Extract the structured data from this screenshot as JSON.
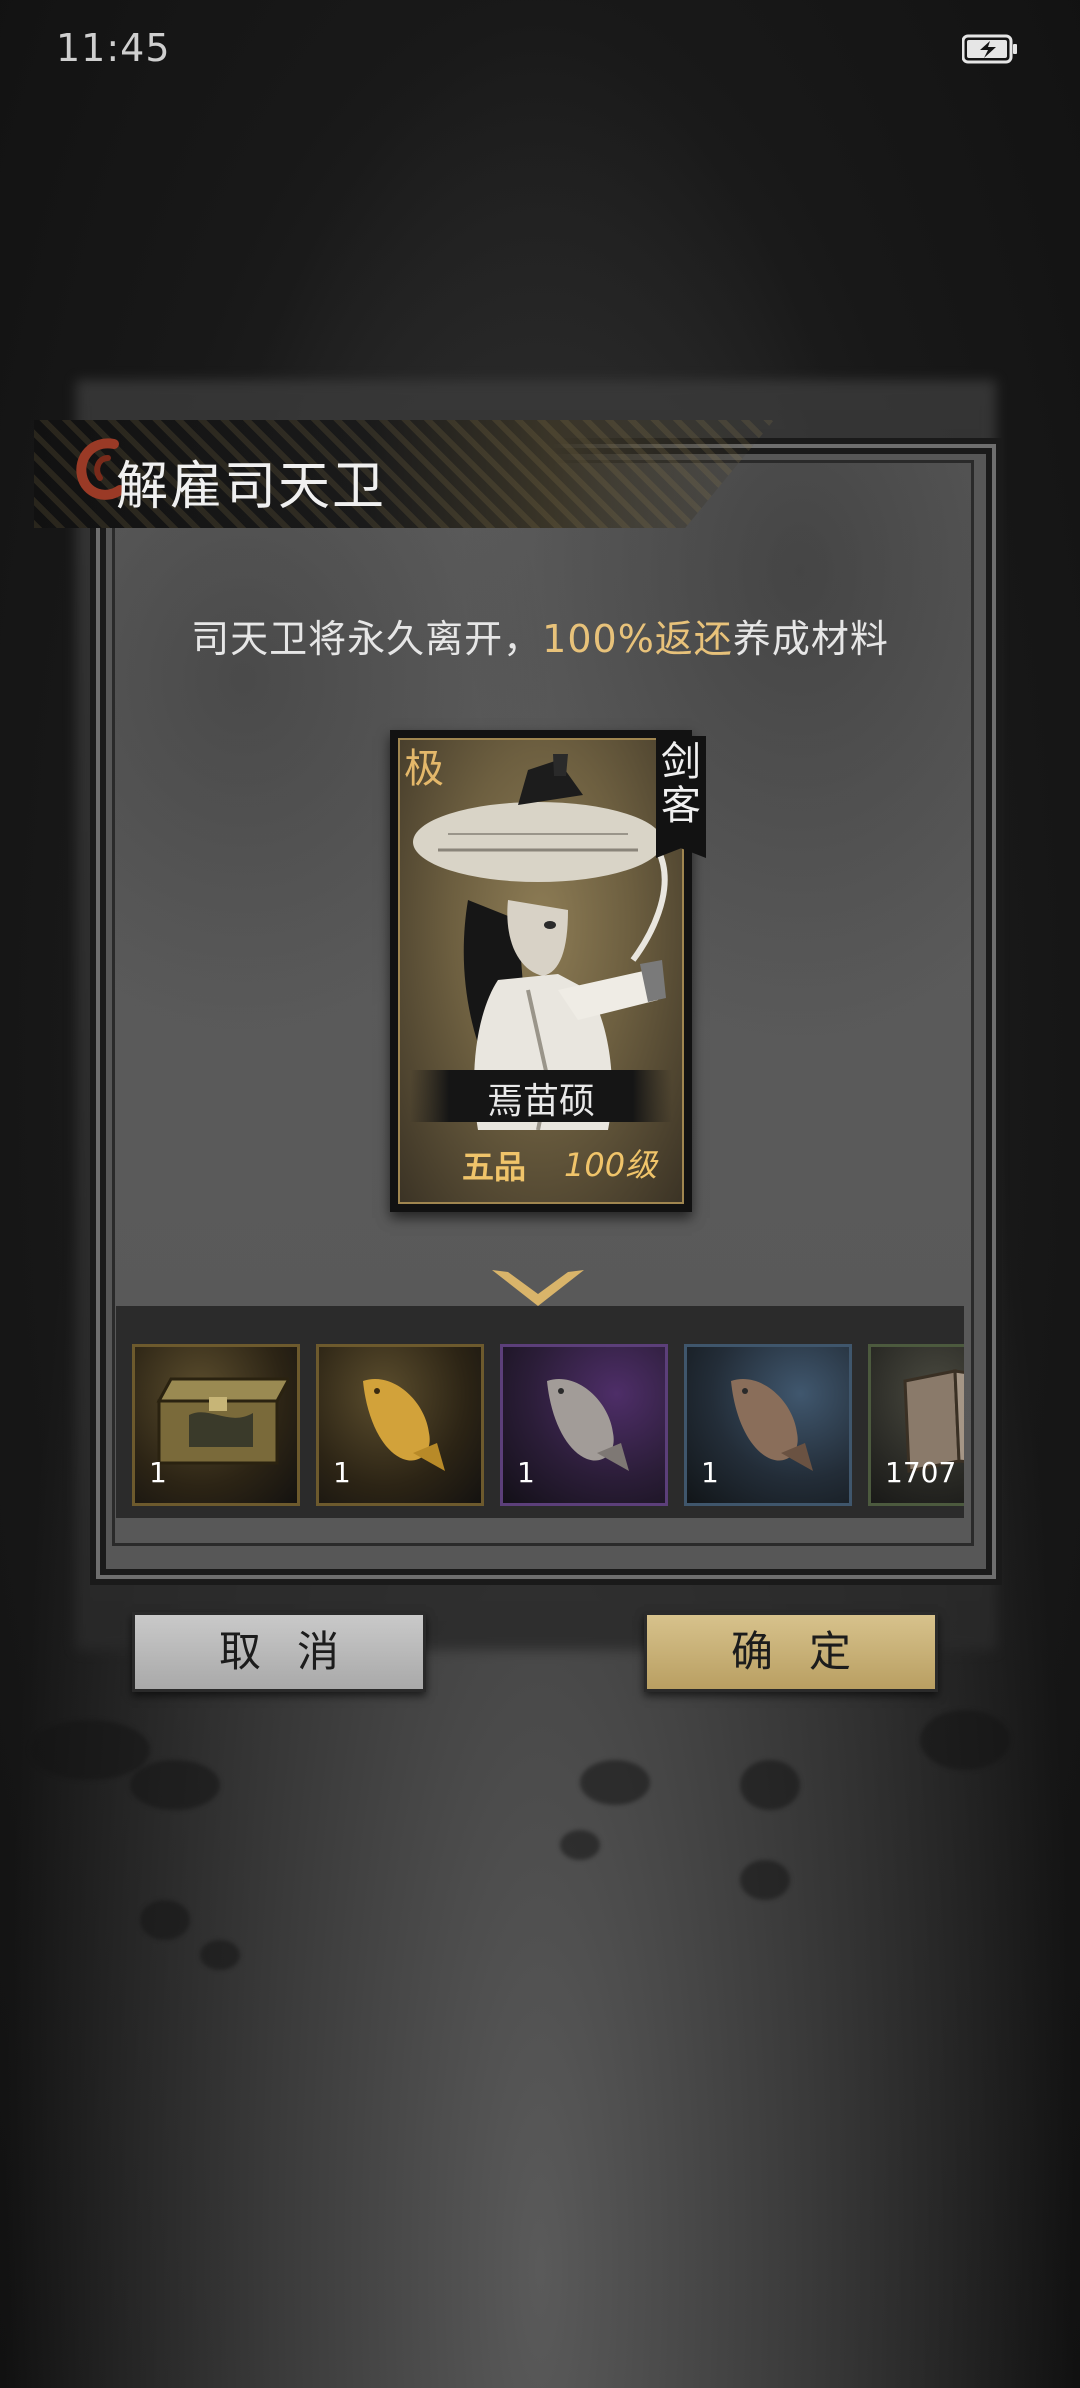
{
  "status_bar": {
    "time": "11:45"
  },
  "dialog": {
    "title": "解雇司天卫",
    "subtitle_prefix": "司天卫将永久离开，",
    "subtitle_highlight": "100%返还",
    "subtitle_suffix": "养成材料",
    "highlight_color": "#e8c27a"
  },
  "card": {
    "rank": "极",
    "class": "剑客",
    "name": "焉苗硕",
    "grade": "五品",
    "level": "100级"
  },
  "rewards": [
    {
      "icon": "treasure-chest",
      "count": "1"
    },
    {
      "icon": "golden-carp",
      "count": "1"
    },
    {
      "icon": "silver-carp",
      "count": "1"
    },
    {
      "icon": "bronze-carp",
      "count": "1"
    },
    {
      "icon": "book",
      "count": "1707"
    }
  ],
  "buttons": {
    "cancel": "取消",
    "confirm": "确定"
  }
}
